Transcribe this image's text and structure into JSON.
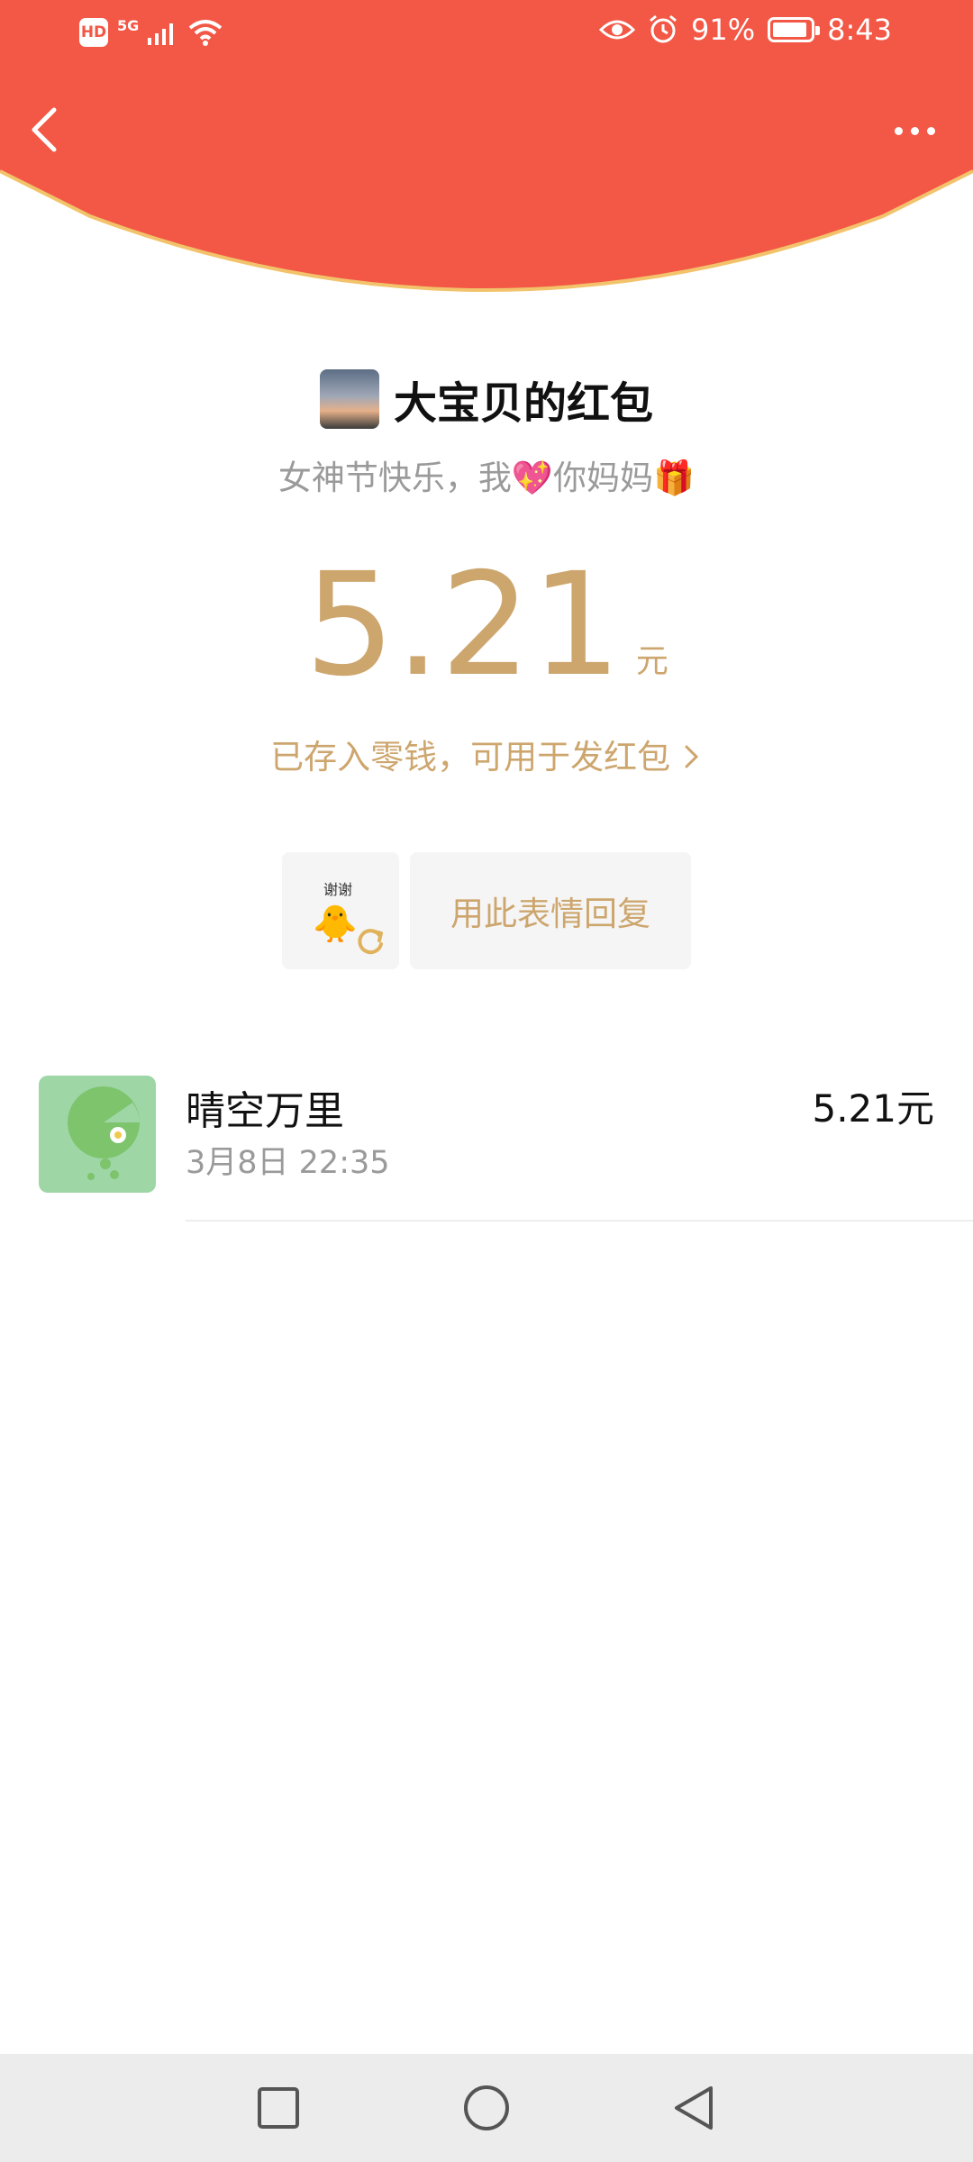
{
  "status_bar": {
    "hd": "HD",
    "network": "5G",
    "battery_text": "91%",
    "battery_level": 0.91,
    "time": "8:43"
  },
  "colors": {
    "header_red": "#F35745",
    "header_edge": "#F2C36B",
    "gold": "#CDA66E"
  },
  "icons": {
    "back": "chevron-left",
    "more": "ellipsis",
    "eye": "eye",
    "alarm": "alarm-clock",
    "refresh": "refresh"
  },
  "envelope": {
    "sender": "大宝贝的红包",
    "greeting": "女神节快乐，我💖你妈妈🎁",
    "amount": "5.21",
    "unit": "元",
    "saved_note": "已存入零钱，可用于发红包",
    "sticker_text": "谢谢",
    "reply_label": "用此表情回复"
  },
  "records": [
    {
      "name": "晴空万里",
      "time": "3月8日  22:35",
      "amount": "5.21元"
    }
  ]
}
